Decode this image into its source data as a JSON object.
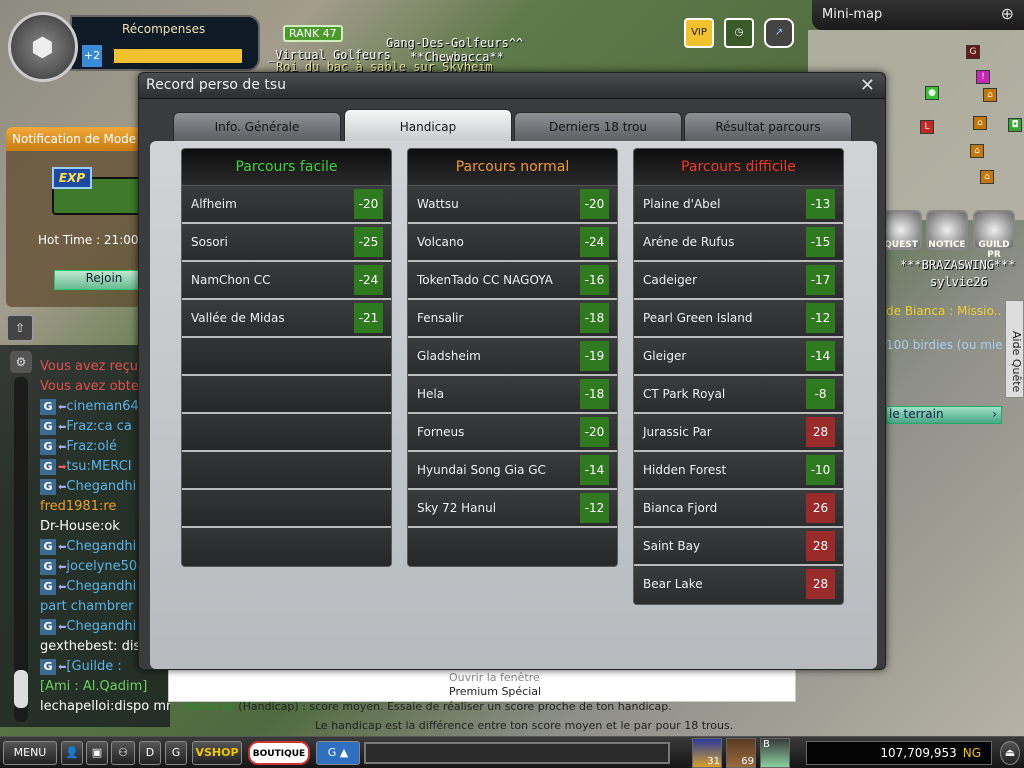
{
  "hud": {
    "rewards_title": "Récompenses",
    "rewards_bonus": "+2",
    "rank": "RANK 47",
    "nametags": [
      "Gang-Des-Golfeurs^^",
      "_Virtual Golfeurs",
      "**Chewbacca**",
      "Roi du bac à sable sur Skyheim"
    ],
    "minimap_title": "Mini-map",
    "quest_buttons": [
      "QUEST",
      "NOTICE",
      "GUILD PR"
    ],
    "players": [
      "***BRAZASWING***",
      "sylvie26"
    ],
    "quest_lines": [
      "de Bianca : Missio..",
      "100 birdies (ou mie"
    ],
    "quest_link": "le terrain",
    "quest_help": "Aide Quête",
    "premium_line1": "Ouvrir la fenêtre",
    "premium_line2": "Premium Spécial"
  },
  "notification": {
    "title": "Notification de Mode M",
    "badge": "EXP",
    "hot_time": "Hot Time : 21:00",
    "join_label": "Rejoin"
  },
  "chat": {
    "lines": [
      {
        "text": "Vous avez reçu",
        "color": "#e05050",
        "g": false
      },
      {
        "text": "Vous avez obtenu",
        "color": "#e05050",
        "g": false
      },
      {
        "text": "cineman64",
        "color": "#5ab4e8",
        "g": true,
        "dir": "in"
      },
      {
        "text": "Fraz:ca ca",
        "color": "#5ab4e8",
        "g": true,
        "dir": "in"
      },
      {
        "text": "Fraz:olé",
        "color": "#5ab4e8",
        "g": true,
        "dir": "in"
      },
      {
        "text": "tsu:MERCI",
        "color": "#5ab4e8",
        "g": true,
        "dir": "out"
      },
      {
        "text": "Chegandhi",
        "color": "#5ab4e8",
        "g": true,
        "dir": "in"
      },
      {
        "text": "fred1981:re",
        "color": "#f0a020",
        "g": false
      },
      {
        "text": "Dr-House:ok",
        "color": "#ffffff",
        "g": false
      },
      {
        "text": "Chegandhi",
        "color": "#5ab4e8",
        "g": true,
        "dir": "in"
      },
      {
        "text": "jocelyne50",
        "color": "#5ab4e8",
        "g": true,
        "dir": "in"
      },
      {
        "text": "Chegandhi",
        "color": "#5ab4e8",
        "g": true,
        "dir": "in"
      },
      {
        "text": " part chambrer",
        "color": "#5ab4e8",
        "g": false
      },
      {
        "text": "Chegandhi",
        "color": "#5ab4e8",
        "g": true,
        "dir": "in"
      },
      {
        "text": "gexthebest: dispo",
        "color": "#ffffff",
        "g": false
      },
      {
        "text": "[Guilde :",
        "color": "#5ab4e8",
        "g": true,
        "dir": "in"
      },
      {
        "text": "[Ami : Al.Qadim]",
        "color": "#6ed060",
        "g": false
      },
      {
        "text": "lechapelloi:dispo mm",
        "color": "#ffffff",
        "g": false
      }
    ]
  },
  "modal": {
    "title": "Record perso de tsu",
    "tabs": [
      {
        "label": "Info. Générale",
        "active": false
      },
      {
        "label": "Handicap",
        "active": true
      },
      {
        "label": "Derniers 18 trou",
        "active": false
      },
      {
        "label": "Résultat parcours",
        "active": false
      }
    ],
    "columns": [
      {
        "title": "Parcours facile",
        "color": "#3fd13f",
        "slots": 10,
        "courses": [
          {
            "name": "Alfheim",
            "score": "-20"
          },
          {
            "name": "Sosori",
            "score": "-25"
          },
          {
            "name": "NamChon CC",
            "score": "-24"
          },
          {
            "name": "Vallée de Midas",
            "score": "-21"
          }
        ]
      },
      {
        "title": "Parcours normal",
        "color": "#f09a30",
        "slots": 10,
        "courses": [
          {
            "name": "Wattsu",
            "score": "-20"
          },
          {
            "name": "Volcano",
            "score": "-24"
          },
          {
            "name": "TokenTado CC NAGOYA",
            "score": "-16"
          },
          {
            "name": "Fensalir",
            "score": "-18"
          },
          {
            "name": "Gladsheim",
            "score": "-19"
          },
          {
            "name": "Hela",
            "score": "-18"
          },
          {
            "name": "Forneus",
            "score": "-20"
          },
          {
            "name": "Hyundai Song Gia GC",
            "score": "-14"
          },
          {
            "name": "Sky 72 Hanul",
            "score": "-12"
          }
        ]
      },
      {
        "title": "Parcours difficile",
        "color": "#f03a2a",
        "slots": 11,
        "courses": [
          {
            "name": "Plaine d'Abel",
            "score": "-13"
          },
          {
            "name": "Aréne de Rufus",
            "score": "-15"
          },
          {
            "name": "Cadeiger",
            "score": "-17"
          },
          {
            "name": "Pearl Green Island",
            "score": "-12"
          },
          {
            "name": "Gleiger",
            "score": "-14"
          },
          {
            "name": "CT Park Royal",
            "score": "-8"
          },
          {
            "name": "Jurassic Par",
            "score": "28"
          },
          {
            "name": "Hidden Forest",
            "score": "-10"
          },
          {
            "name": "Bianca Fjord",
            "score": "26"
          },
          {
            "name": "Saint Bay",
            "score": "28"
          },
          {
            "name": "Bear Lake",
            "score": "28"
          }
        ]
      }
    ],
    "colors": {
      "negative_score": "#2f7a1e",
      "positive_score": "#9a2b2b",
      "legend_keyword": "#2a8a2a"
    },
    "legend_keyword": "Handicap",
    "legend_line1": " (Handicap) : score moyen. Essaie de réaliser un score proche de ton handicap.",
    "legend_line2": "Le handicap est la différence entre ton score moyen et le par pour 18 trous."
  },
  "bottombar": {
    "menu": "MENU",
    "guild": "G",
    "vshop": "VSHOP",
    "boutique": "BOUTIQUE",
    "chat_channel": "G ▲",
    "items": [
      {
        "count": "31"
      },
      {
        "count": "69"
      },
      {
        "count": "",
        "label": "B"
      }
    ],
    "money": "107,709,953",
    "currency": "NG"
  }
}
